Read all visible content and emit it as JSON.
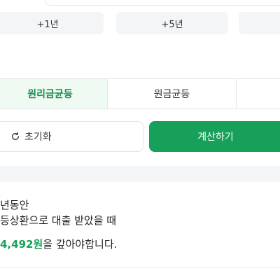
{
  "presets": [
    {
      "label": "+1년"
    },
    {
      "label": "+5년"
    },
    {
      "label": ""
    }
  ],
  "methods": {
    "tabs": [
      {
        "label": "원리금균등",
        "active": true
      },
      {
        "label": "원금균등",
        "active": false
      },
      {
        "label": "",
        "active": false
      }
    ],
    "active_color": "#1d8c52"
  },
  "actions": {
    "reset_label": "초기화",
    "calculate_label": "계산하기",
    "calculate_color": "#17a05a"
  },
  "result": {
    "line1": "년동안",
    "line2": "등상환으로 대출 받았을 때",
    "amount": "4,492원",
    "line3_suffix": "을 갚아야합니다."
  }
}
